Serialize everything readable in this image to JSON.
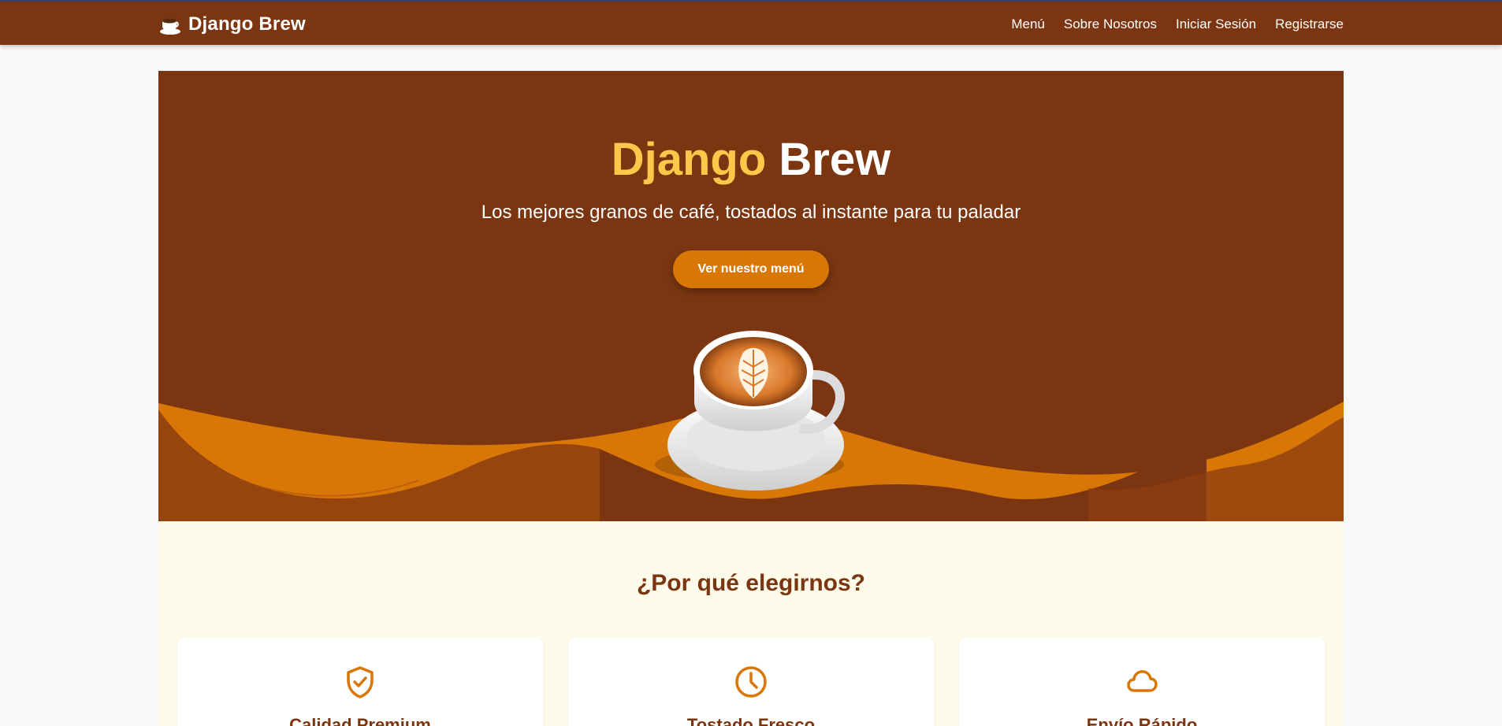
{
  "navbar": {
    "brand": "Django Brew",
    "brand_icon": "coffee-cup-icon",
    "links": [
      "Menú",
      "Sobre Nosotros",
      "Iniciar Sesión",
      "Registrarse"
    ]
  },
  "hero": {
    "title_part1": "Django",
    "title_part2": "Brew",
    "subtitle": "Los mejores granos de café, tostados al instante para tu paladar",
    "cta_label": "Ver nuestro menú",
    "image": "latte-art-coffee-cup-image"
  },
  "features": {
    "title": "¿Por qué elegirnos?",
    "cards": [
      {
        "title": "Calidad Premium",
        "icon": "shield-check-icon"
      },
      {
        "title": "Tostado Fresco",
        "icon": "clock-icon"
      },
      {
        "title": "Envío Rápido",
        "icon": "cloud-icon"
      }
    ]
  },
  "colors": {
    "primary_brown": "#7b3611",
    "accent_orange": "#d97706",
    "title_yellow": "#fbc84a",
    "features_bg": "#fefbeb"
  }
}
